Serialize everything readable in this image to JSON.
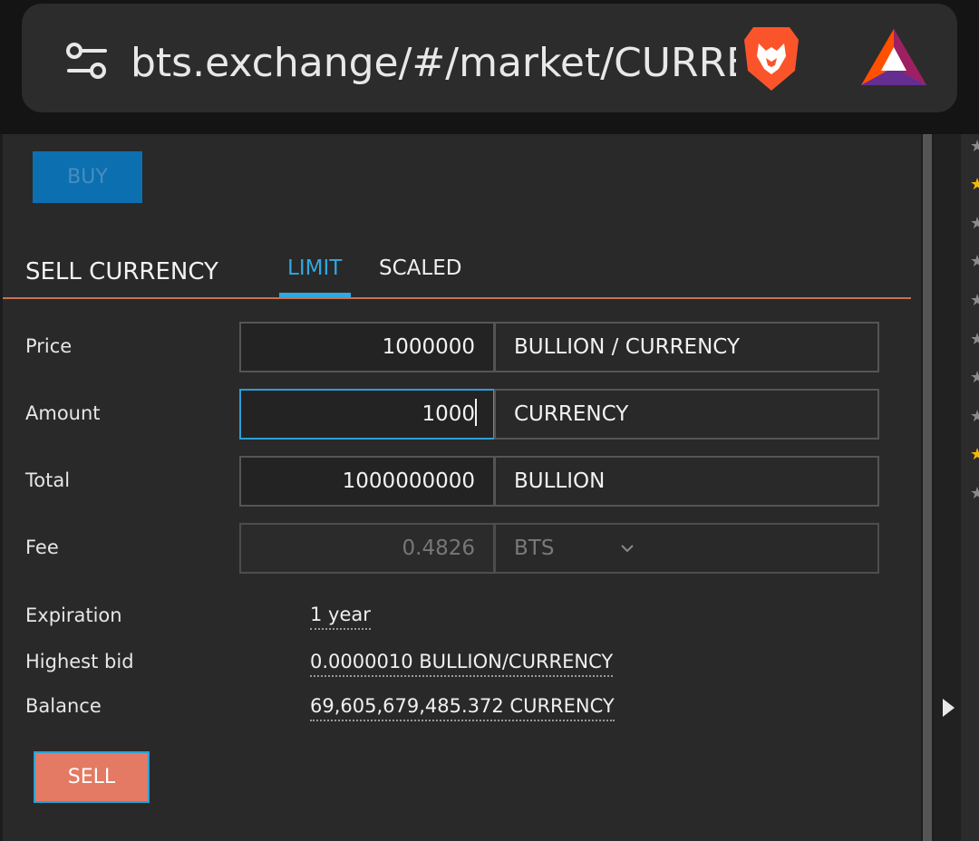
{
  "browser": {
    "url": "bts.exchange/#/market/CURRE",
    "icons": [
      "tune-icon",
      "brave-lion-icon",
      "bat-triangle-icon"
    ]
  },
  "buy_button_label": "BUY",
  "sell_form": {
    "title": "SELL CURRENCY",
    "tabs": [
      {
        "label": "LIMIT",
        "active": true
      },
      {
        "label": "SCALED",
        "active": false
      }
    ],
    "fields": {
      "price": {
        "label": "Price",
        "value": "1000000",
        "unit": "BULLION / CURRENCY"
      },
      "amount": {
        "label": "Amount",
        "value": "1000",
        "unit": "CURRENCY"
      },
      "total": {
        "label": "Total",
        "value": "1000000000",
        "unit": "BULLION"
      },
      "fee": {
        "label": "Fee",
        "value": "0.4826",
        "unit": "BTS"
      }
    },
    "info": {
      "expiration": {
        "label": "Expiration",
        "value": "1 year"
      },
      "highest_bid": {
        "label": "Highest bid",
        "value": "0.0000010 BULLION/CURRENCY"
      },
      "balance": {
        "label": "Balance",
        "value": "69,605,679,485.372 CURRENCY"
      }
    },
    "sell_button_label": "SELL"
  },
  "colors": {
    "accent_blue": "#2fa9e0",
    "buy_blue": "#0b6fb0",
    "sell_red": "#e47a63",
    "divider": "#c9704f",
    "favorite_gold": "#f0b90b"
  }
}
